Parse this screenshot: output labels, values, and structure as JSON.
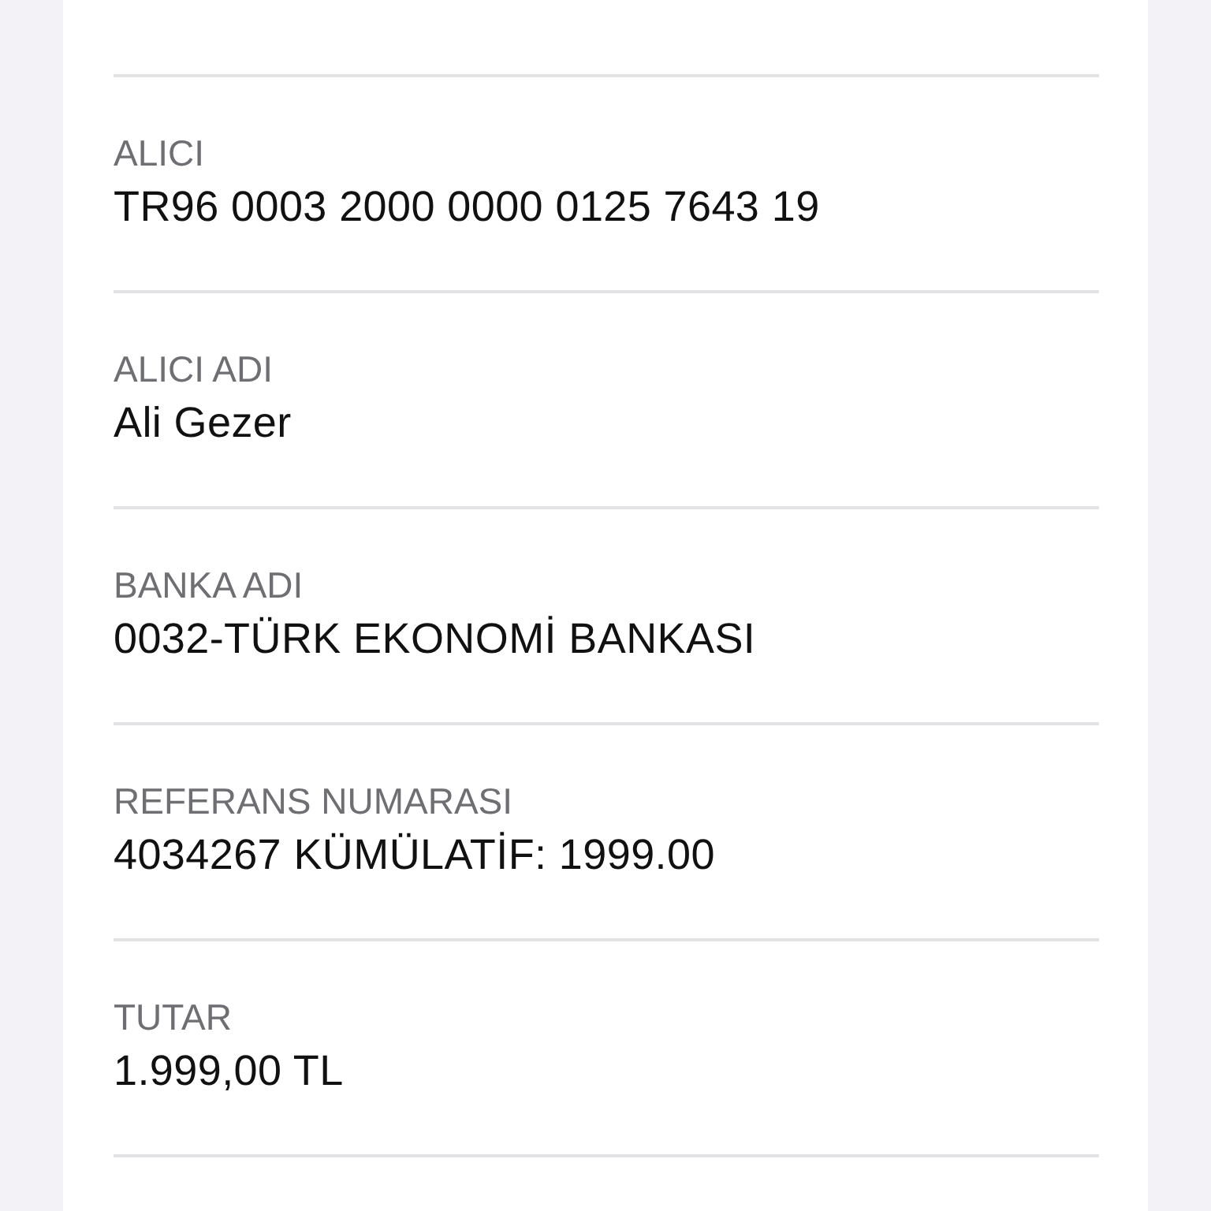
{
  "fields": [
    {
      "label": "ALICI",
      "value": "TR96 0003 2000 0000 0125 7643 19"
    },
    {
      "label": "ALICI ADI",
      "value": "Ali Gezer"
    },
    {
      "label": "BANKA ADI",
      "value": "0032-TÜRK EKONOMİ BANKASI"
    },
    {
      "label": "REFERANS NUMARASI",
      "value": "4034267 KÜMÜLATİF: 1999.00"
    },
    {
      "label": "TUTAR",
      "value": "1.999,00 TL"
    }
  ]
}
